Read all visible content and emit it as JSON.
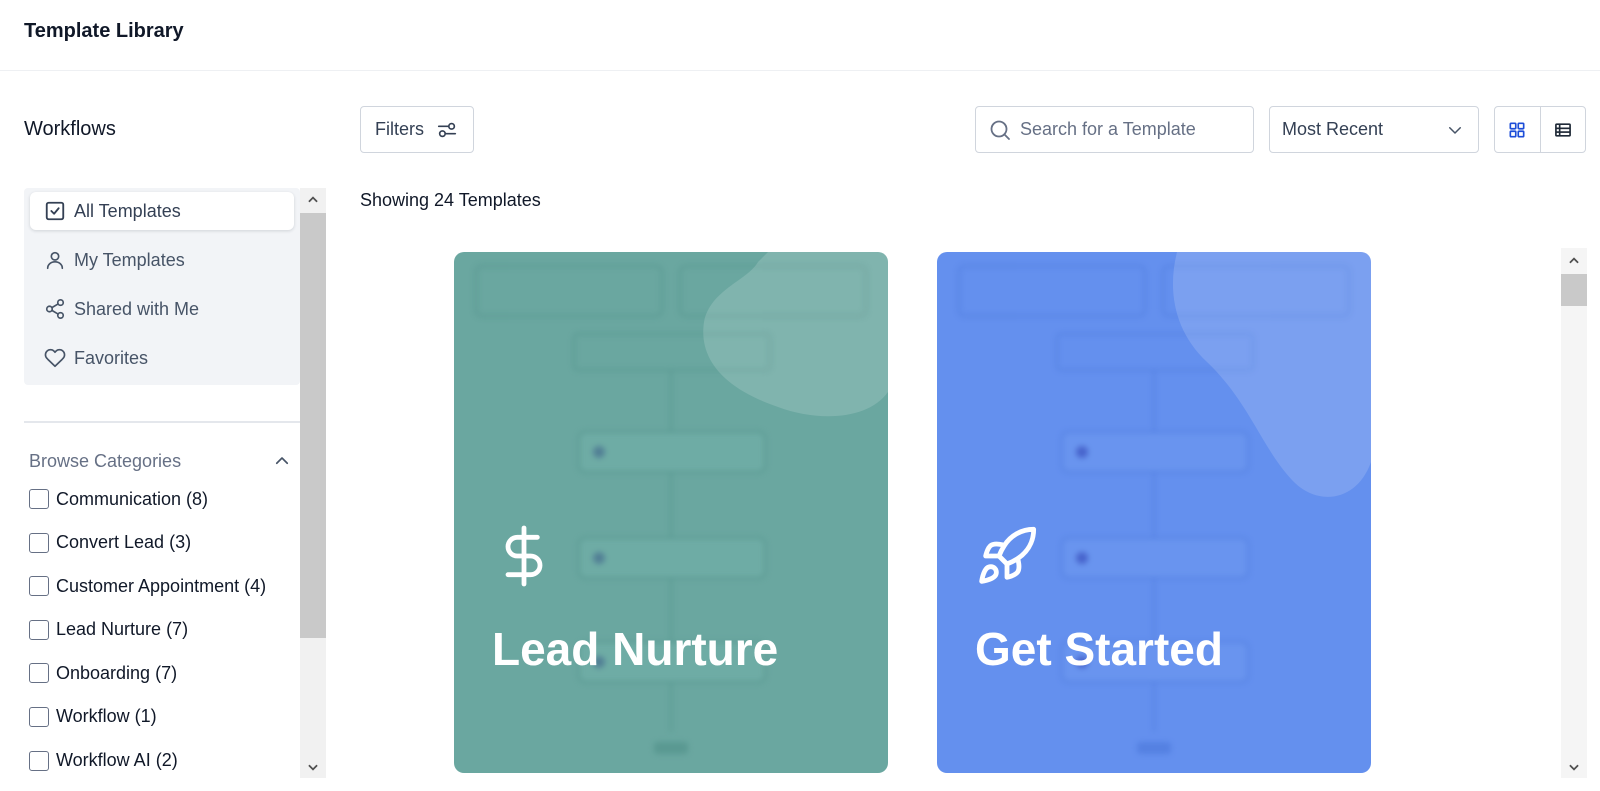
{
  "header": {
    "title": "Template Library"
  },
  "sidebar": {
    "section_title": "Workflows",
    "nav": [
      {
        "label": "All Templates",
        "icon": "check-square-icon",
        "active": true
      },
      {
        "label": "My Templates",
        "icon": "user-icon",
        "active": false
      },
      {
        "label": "Shared with Me",
        "icon": "share-icon",
        "active": false
      },
      {
        "label": "Favorites",
        "icon": "heart-icon",
        "active": false
      }
    ],
    "browse_title": "Browse Categories",
    "categories": [
      {
        "label": "Communication (8)",
        "checked": false
      },
      {
        "label": "Convert Lead (3)",
        "checked": false
      },
      {
        "label": "Customer Appointment (4)",
        "checked": false
      },
      {
        "label": "Lead Nurture (7)",
        "checked": false
      },
      {
        "label": "Onboarding (7)",
        "checked": false
      },
      {
        "label": "Workflow (1)",
        "checked": false
      },
      {
        "label": "Workflow AI (2)",
        "checked": false
      }
    ]
  },
  "toolbar": {
    "filters_label": "Filters",
    "search_placeholder": "Search for a Template",
    "search_value": "",
    "sort_value": "Most Recent",
    "view_active": "grid"
  },
  "main": {
    "count_text": "Showing 24 Templates",
    "cards": [
      {
        "title": "Lead Nurture",
        "icon": "dollar-icon",
        "color": "#6aa7a0"
      },
      {
        "title": "Get Started",
        "icon": "rocket-icon",
        "color": "#6490ee"
      }
    ]
  },
  "colors": {
    "accent": "#1d4ed8",
    "lead_nurture_card": "#6aa7a0",
    "get_started_card": "#6490ee"
  }
}
